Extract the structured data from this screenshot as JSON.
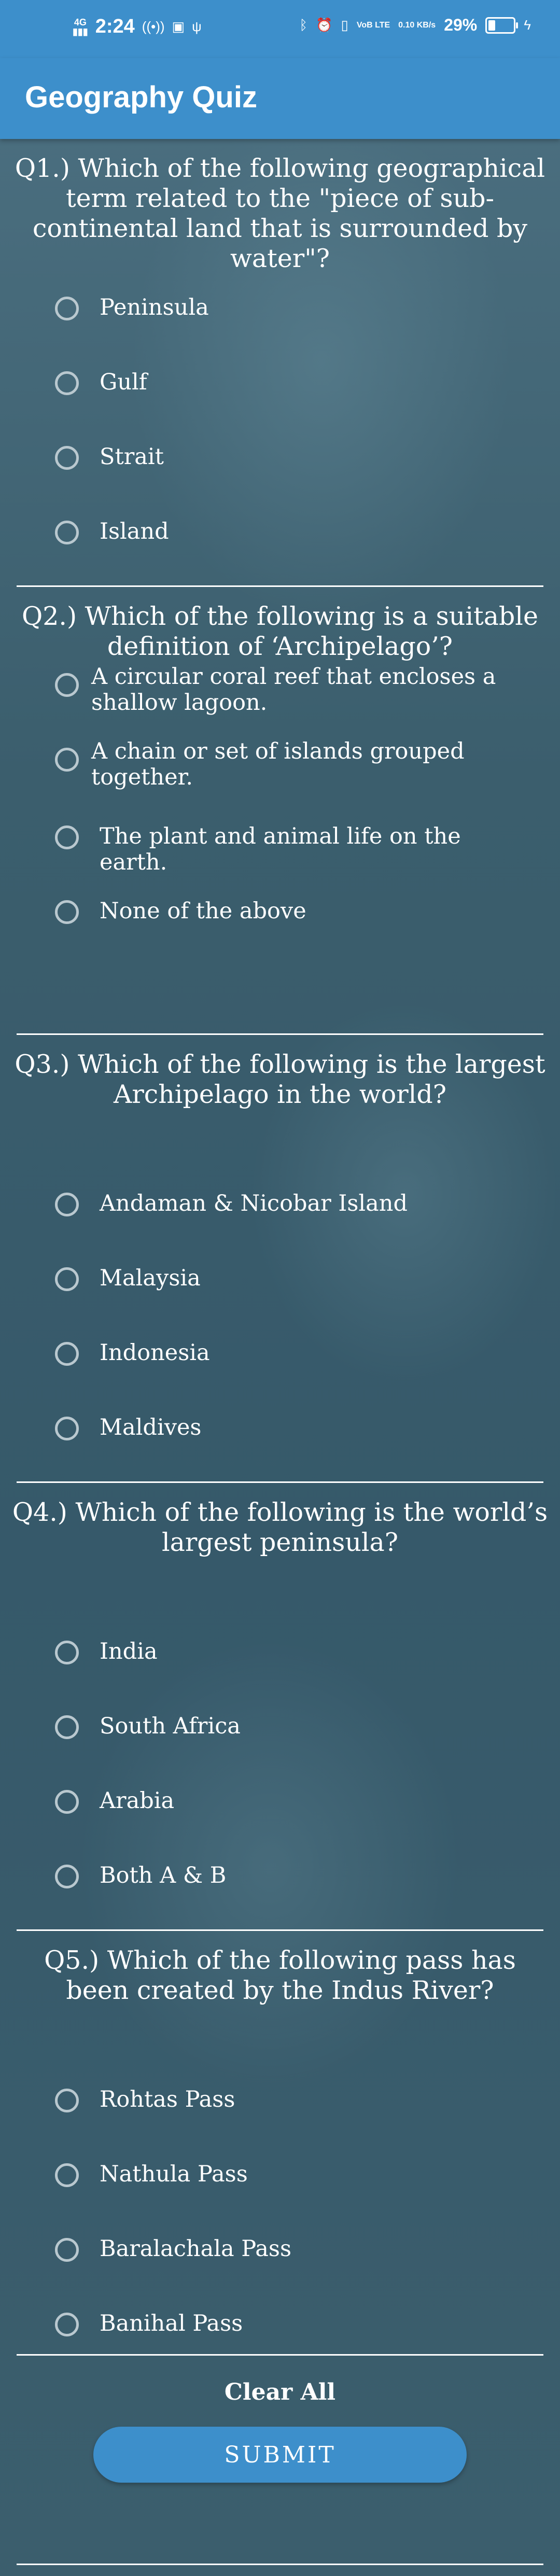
{
  "status_bar": {
    "network": "4G",
    "signal": "▮▮▮",
    "time": "2:24",
    "icons_left": [
      "hotspot-icon",
      "vo-icon",
      "usb-icon"
    ],
    "icons_right": [
      "bluetooth-icon",
      "alarm-icon",
      "vibrate-icon"
    ],
    "lte": "VoB LTE",
    "speed": "0.10 KB/s",
    "battery_percent": "29%",
    "battery_level": 0.29
  },
  "app": {
    "title": "Geography Quiz"
  },
  "questions": [
    {
      "text": "Q1.) Which of the following geographical term related to the \"piece of sub-continental land that is surrounded by water\"?",
      "options": [
        "Peninsula",
        "Gulf",
        "Strait",
        "Island"
      ]
    },
    {
      "text": "Q2.) Which of the following is a suitable definition of ‘Archipelago’?",
      "options": [
        "A circular coral reef that encloses a shallow lagoon.",
        "A chain or set of islands grouped together.",
        "The plant and animal life on the earth.",
        "None of the above"
      ]
    },
    {
      "text": "Q3.) Which of the following is the largest Archipelago in the world?",
      "options": [
        "Andaman & Nicobar Island",
        "Malaysia",
        "Indonesia",
        "Maldives"
      ]
    },
    {
      "text": "Q4.) Which of the following is the world’s largest peninsula?",
      "options": [
        "India",
        "South Africa",
        "Arabia",
        "Both A & B"
      ]
    },
    {
      "text": "Q5.) Which of the following pass has been created by the Indus River?",
      "options": [
        "Rohtas Pass",
        "Nathula Pass",
        "Baralachala Pass",
        "Banihal Pass"
      ]
    }
  ],
  "actions": {
    "clear_all": "Clear All",
    "submit": "SUBMIT"
  },
  "colors": {
    "app_bar": "#3d8fcb",
    "background": "#3e6170",
    "text": "#ffffff",
    "radio_border": "#b9c8cf"
  }
}
